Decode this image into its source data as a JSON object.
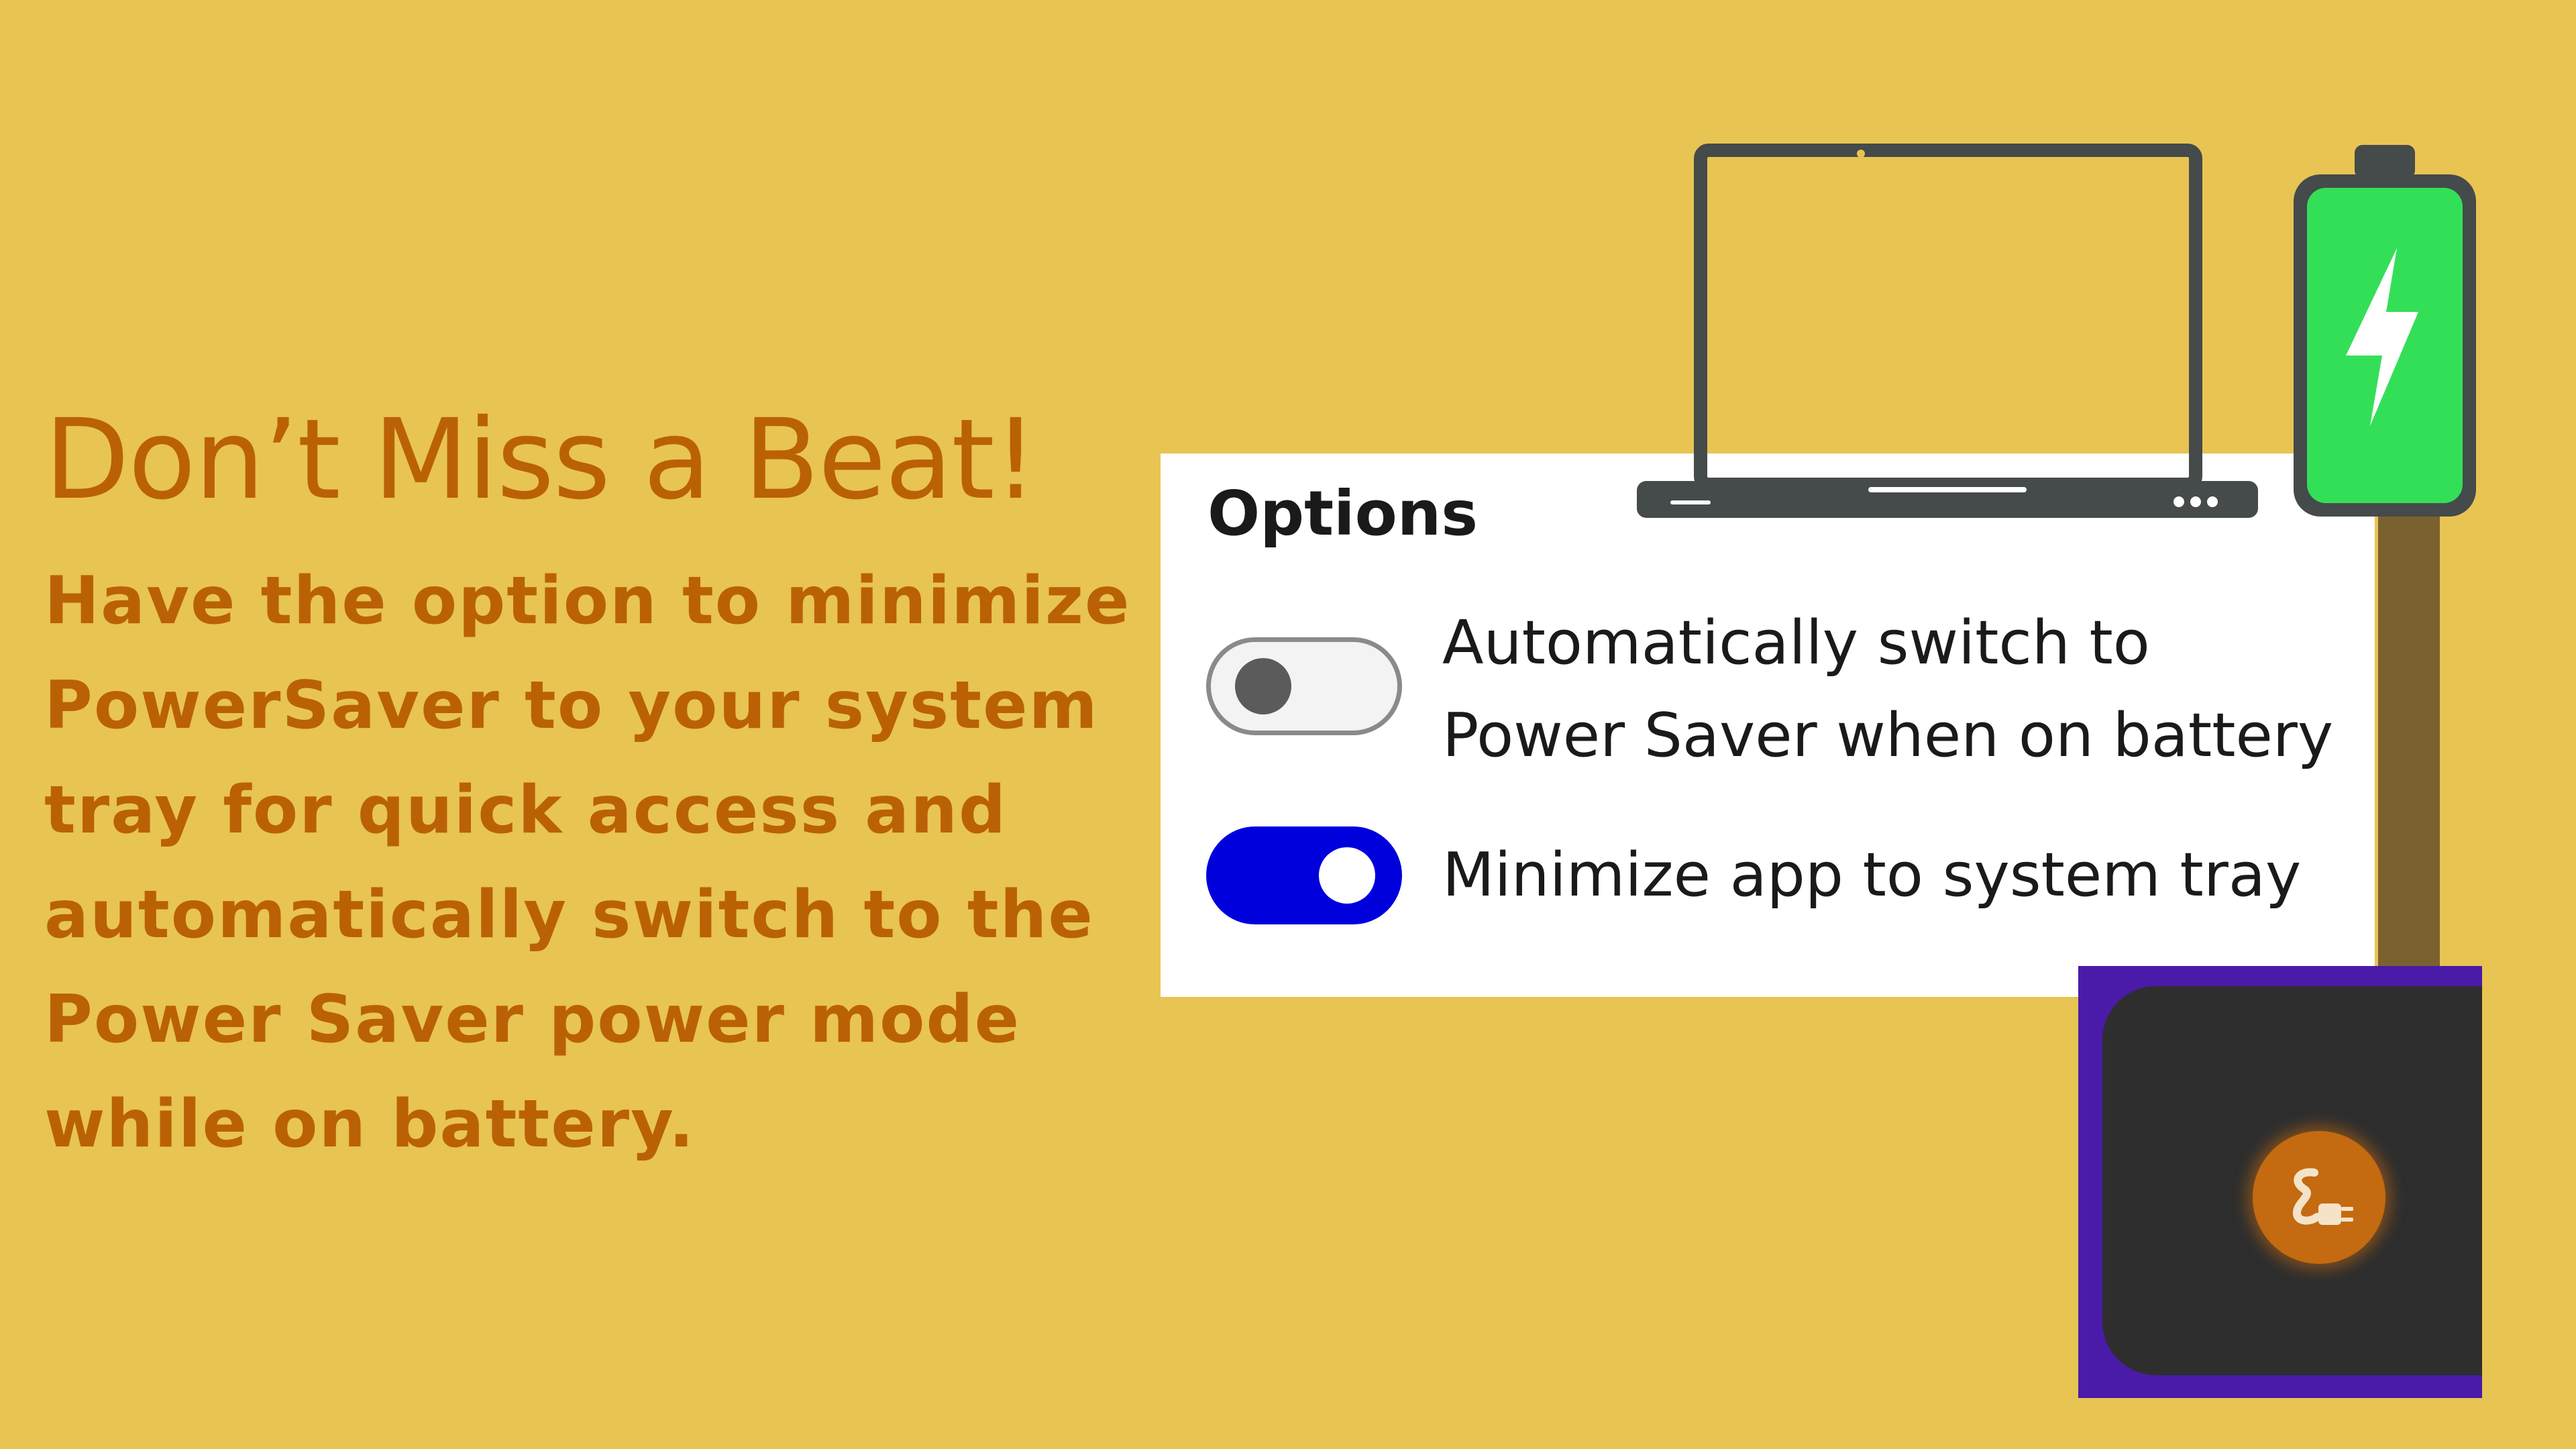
{
  "headline": "Don’t Miss a Beat!",
  "body_lines": [
    "Have the option to minimize",
    "PowerSaver to your system",
    "tray for quick access and",
    "automatically switch to the",
    "Power Saver power mode",
    "while on battery."
  ],
  "options": {
    "title": "Options",
    "auto_switch": {
      "label_line1": "Automatically switch to",
      "label_line2": "Power Saver when on battery",
      "state": "off"
    },
    "minimize_tray": {
      "label": "Minimize app to system tray",
      "state": "on"
    }
  },
  "icons": {
    "laptop": "laptop-icon",
    "battery": "battery-charging-icon",
    "tray_app": "power-plug-icon"
  },
  "colors": {
    "background": "#E8C452",
    "text_accent": "#BA6106",
    "toggle_on": "#0000DD",
    "battery_fill": "#34DF58",
    "tray_panel": "#4A1BA8",
    "tray_icon": "#C46A10"
  }
}
